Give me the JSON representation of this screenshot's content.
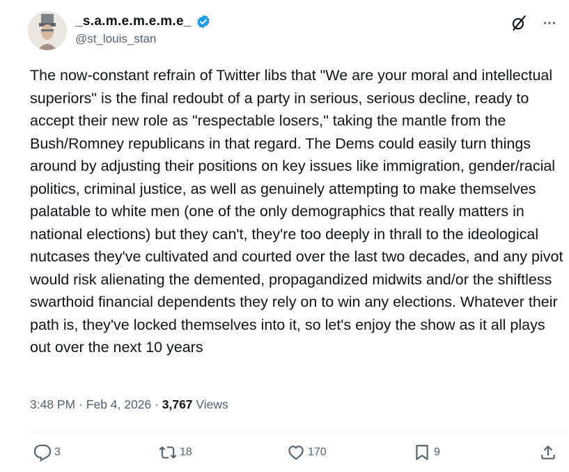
{
  "user": {
    "display_name": "_s.a.m.e.m.e.m.e_",
    "handle": "@st_louis_stan"
  },
  "tweet": {
    "text": "The now-constant refrain of Twitter libs that \"We are your moral and intellectual superiors\" is the final redoubt of a party in serious, serious decline, ready to accept their new role as \"respectable losers,\" taking the mantle from the Bush/Romney republicans in that regard. The Dems could easily turn things around by adjusting their positions on key issues like immigration, gender/racial politics, criminal justice, as well as genuinely attempting to make themselves palatable to white men (one of the only demographics that really matters in national elections) but they can't, they're too deeply in thrall to the ideological nutcases they've cultivated and courted over the last two decades, and any pivot would risk alienating the demented, propagandized midwits and/or the shiftless swarthoid financial dependents they rely on to win any elections. Whatever their path is, they've locked themselves into it, so let's enjoy the show as it all plays out over the next 10 years"
  },
  "meta": {
    "time": "3:48 PM",
    "separator": "·",
    "date": "Feb 4, 2026",
    "views_count": "3,767",
    "views_label": "Views"
  },
  "actions": {
    "replies": "3",
    "reposts": "18",
    "likes": "170",
    "bookmarks": "9"
  },
  "icons": {
    "verified": "verified-badge-icon",
    "grok": "grok-slash-icon",
    "more": "more-dots-icon",
    "reply": "reply-icon",
    "repost": "repost-icon",
    "like": "heart-icon",
    "bookmark": "bookmark-icon",
    "share": "share-icon"
  },
  "colors": {
    "text": "#0f1419",
    "secondary": "#536471",
    "verified": "#1d9bf0"
  }
}
